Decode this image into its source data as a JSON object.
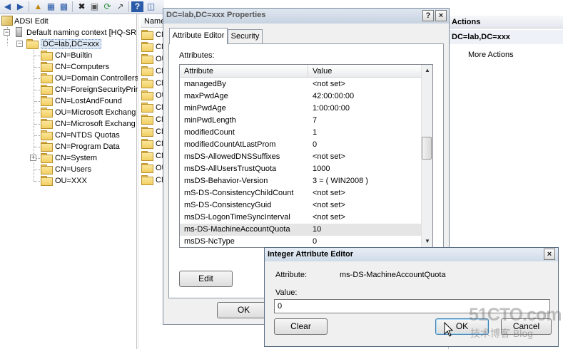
{
  "tree": {
    "root_label": "ADSI Edit",
    "context_label": "Default naming context [HQ-SR",
    "selected_label": "DC=lab,DC=xxx",
    "children": [
      {
        "label": "CN=Builtin",
        "expandable": false
      },
      {
        "label": "CN=Computers",
        "expandable": false
      },
      {
        "label": "OU=Domain Controllers",
        "expandable": false
      },
      {
        "label": "CN=ForeignSecurityPrin",
        "expandable": false
      },
      {
        "label": "CN=LostAndFound",
        "expandable": false
      },
      {
        "label": "OU=Microsoft Exchang",
        "expandable": false
      },
      {
        "label": "CN=Microsoft Exchang",
        "expandable": false
      },
      {
        "label": "CN=NTDS Quotas",
        "expandable": false
      },
      {
        "label": "CN=Program Data",
        "expandable": false
      },
      {
        "label": "CN=System",
        "expandable": true
      },
      {
        "label": "CN=Users",
        "expandable": false
      },
      {
        "label": "OU=XXX",
        "expandable": false
      }
    ]
  },
  "middle": {
    "header": "Name",
    "rows": [
      "CN",
      "CN",
      "OU",
      "CN",
      "CN",
      "OU",
      "CN",
      "CN",
      "CN",
      "CN",
      "CN",
      "OU",
      "CN"
    ]
  },
  "actions": {
    "title": "Actions",
    "subtitle": "DC=lab,DC=xxx",
    "more": "More Actions"
  },
  "properties_dialog": {
    "title": "DC=lab,DC=xxx Properties",
    "help_btn": "?",
    "close_btn": "×",
    "tabs": [
      {
        "label": "Attribute Editor",
        "active": true
      },
      {
        "label": "Security",
        "active": false
      }
    ],
    "attributes_label": "Attributes:",
    "columns": [
      "Attribute",
      "Value"
    ],
    "rows": [
      {
        "name": "managedBy",
        "value": "<not set>"
      },
      {
        "name": "maxPwdAge",
        "value": "42:00:00:00"
      },
      {
        "name": "minPwdAge",
        "value": "1:00:00:00"
      },
      {
        "name": "minPwdLength",
        "value": "7"
      },
      {
        "name": "modifiedCount",
        "value": "1"
      },
      {
        "name": "modifiedCountAtLastProm",
        "value": "0"
      },
      {
        "name": "msDS-AllowedDNSSuffixes",
        "value": "<not set>"
      },
      {
        "name": "msDS-AllUsersTrustQuota",
        "value": "1000"
      },
      {
        "name": "msDS-Behavior-Version",
        "value": "3 = ( WIN2008 )"
      },
      {
        "name": "mS-DS-ConsistencyChildCount",
        "value": "<not set>"
      },
      {
        "name": "mS-DS-ConsistencyGuid",
        "value": "<not set>"
      },
      {
        "name": "msDS-LogonTimeSyncInterval",
        "value": "<not set>"
      },
      {
        "name": "ms-DS-MachineAccountQuota",
        "value": "10",
        "selected": true
      },
      {
        "name": "msDS-NcType",
        "value": "0"
      }
    ],
    "edit_btn": "Edit",
    "ok_btn": "OK"
  },
  "integer_editor": {
    "title": "Integer Attribute Editor",
    "close_btn": "×",
    "attribute_label": "Attribute:",
    "attribute_value": "ms-DS-MachineAccountQuota",
    "value_label": "Value:",
    "value": "0",
    "clear_btn": "Clear",
    "ok_btn": "OK",
    "cancel_btn": "Cancel"
  },
  "watermark": {
    "top": "51CTO.com",
    "bottom": "技术博客  Blog"
  }
}
